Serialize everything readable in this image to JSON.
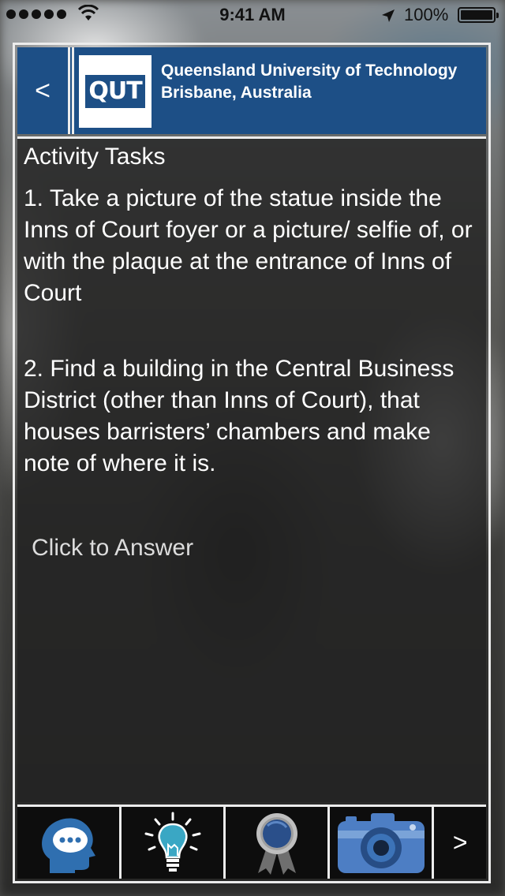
{
  "status_bar": {
    "time": "9:41 AM",
    "battery_pct": "100%",
    "signal_bars": 5,
    "icons": [
      "signal-dots-icon",
      "wifi-icon",
      "location-arrow-icon",
      "battery-icon"
    ]
  },
  "header": {
    "back_label": "<",
    "logo_text": "QUT",
    "university_line1": "Queensland University of Technology",
    "university_line2": "Brisbane, Australia",
    "brand_color": "#1d4f86"
  },
  "content": {
    "title": "Activity Tasks",
    "task1": "1. Take a picture of the statue inside the Inns of Court foyer or a picture/ selfie of, or with the plaque at the entrance of Inns of Court",
    "task2": "2. Find a building in the Central Business District (other than Inns of Court), that houses barristers’ chambers and make note of where it is.",
    "answer_link": "Click to Answer"
  },
  "toolbar": {
    "items": [
      {
        "icon": "chat-head-icon"
      },
      {
        "icon": "lightbulb-icon"
      },
      {
        "icon": "award-ribbon-icon"
      },
      {
        "icon": "camera-icon"
      }
    ],
    "next_label": ">"
  }
}
